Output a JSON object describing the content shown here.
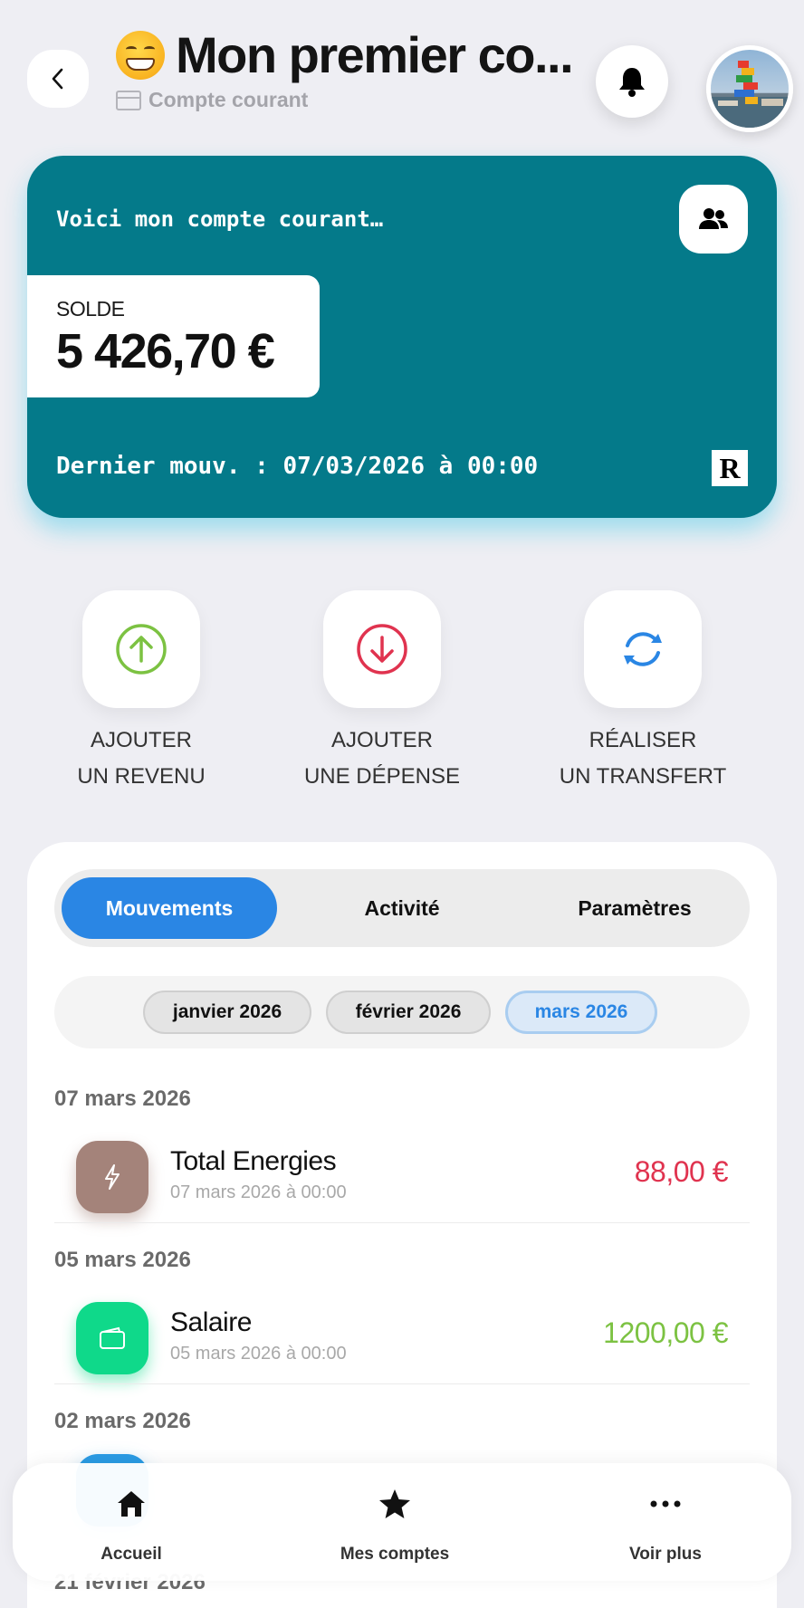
{
  "header": {
    "title": "Mon premier co...",
    "subtitle": "Compte courant"
  },
  "account_card": {
    "caption": "Voici mon compte courant…",
    "balance_label": "SOLDE",
    "balance_value": "5 426,70 €",
    "last_movement": "Dernier mouv. : 07/03/2026 à 00:00",
    "brand_letter": "R",
    "color": "#047a8a"
  },
  "actions": [
    {
      "line1": "AJOUTER",
      "line2": "UN REVENU",
      "icon": "arrow-up-circle-icon",
      "color": "#7cc242"
    },
    {
      "line1": "AJOUTER",
      "line2": "UNE DÉPENSE",
      "icon": "arrow-down-circle-icon",
      "color": "#e0334f"
    },
    {
      "line1": "RÉALISER",
      "line2": "UN TRANSFERT",
      "icon": "refresh-icon",
      "color": "#2a86e4"
    }
  ],
  "tabs": [
    "Mouvements",
    "Activité",
    "Paramètres"
  ],
  "active_tab": "Mouvements",
  "months": [
    "janvier 2026",
    "février 2026",
    "mars 2026"
  ],
  "active_month": "mars 2026",
  "groups": [
    {
      "date": "07 mars 2026",
      "transactions": [
        {
          "name": "Total Energies",
          "datetime": "07 mars 2026 à 00:00",
          "amount": "88,00 €",
          "type": "expense",
          "icon": "lightning-icon",
          "color": "#a4837a"
        }
      ]
    },
    {
      "date": "05 mars 2026",
      "transactions": [
        {
          "name": "Salaire",
          "datetime": "05 mars 2026 à 00:00",
          "amount": "1200,00 €",
          "type": "income",
          "icon": "wallet-icon",
          "color": "#0fd98a"
        }
      ]
    },
    {
      "date": "02 mars 2026",
      "transactions": []
    },
    {
      "date": "21 février 2026",
      "transactions": []
    }
  ],
  "colors": {
    "income": "#7cc242",
    "expense": "#e0334f",
    "accent": "#2a86e4"
  },
  "nav": [
    {
      "label": "Accueil",
      "icon": "home-icon"
    },
    {
      "label": "Mes comptes",
      "icon": "star-icon"
    },
    {
      "label": "Voir plus",
      "icon": "more-icon"
    }
  ]
}
